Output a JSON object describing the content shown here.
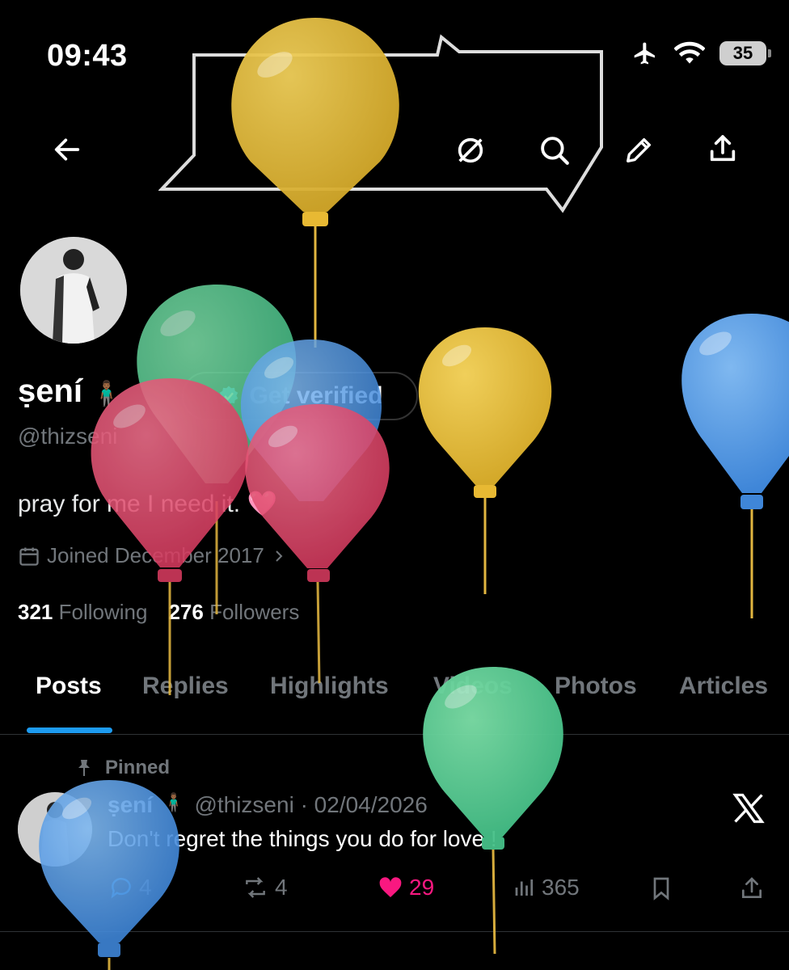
{
  "status_bar": {
    "time": "09:43",
    "battery": "35"
  },
  "profile": {
    "name": "ṣení",
    "emoji": "🧍🏾‍♂️",
    "verify_label": "Get verified",
    "handle": "@thizseni",
    "bio": "pray for me I need it.",
    "bio_emoji": "🩷",
    "joined": "Joined December 2017",
    "following_count": "321",
    "following_label": "Following",
    "followers_count": "276",
    "followers_label": "Followers"
  },
  "tabs": [
    "Posts",
    "Replies",
    "Highlights",
    "Videos",
    "Photos",
    "Articles"
  ],
  "post": {
    "pinned_label": "Pinned",
    "name": "ṣení",
    "emoji": "🧍🏾‍♂️",
    "meta": "@thizseni · 02/04/2026",
    "text": "Don't regret the things you do for love !",
    "replies": "4",
    "reposts": "4",
    "likes": "29",
    "views": "365"
  },
  "colors": {
    "accent": "#1d9bf0",
    "like": "#f91880",
    "muted": "#71767b"
  },
  "icons": [
    "back-arrow-icon",
    "grok-icon",
    "search-icon",
    "edit-icon",
    "share-icon",
    "calendar-icon",
    "pin-icon",
    "x-logo-icon",
    "reply-icon",
    "repost-icon",
    "heart-icon",
    "views-icon",
    "bookmark-icon"
  ]
}
